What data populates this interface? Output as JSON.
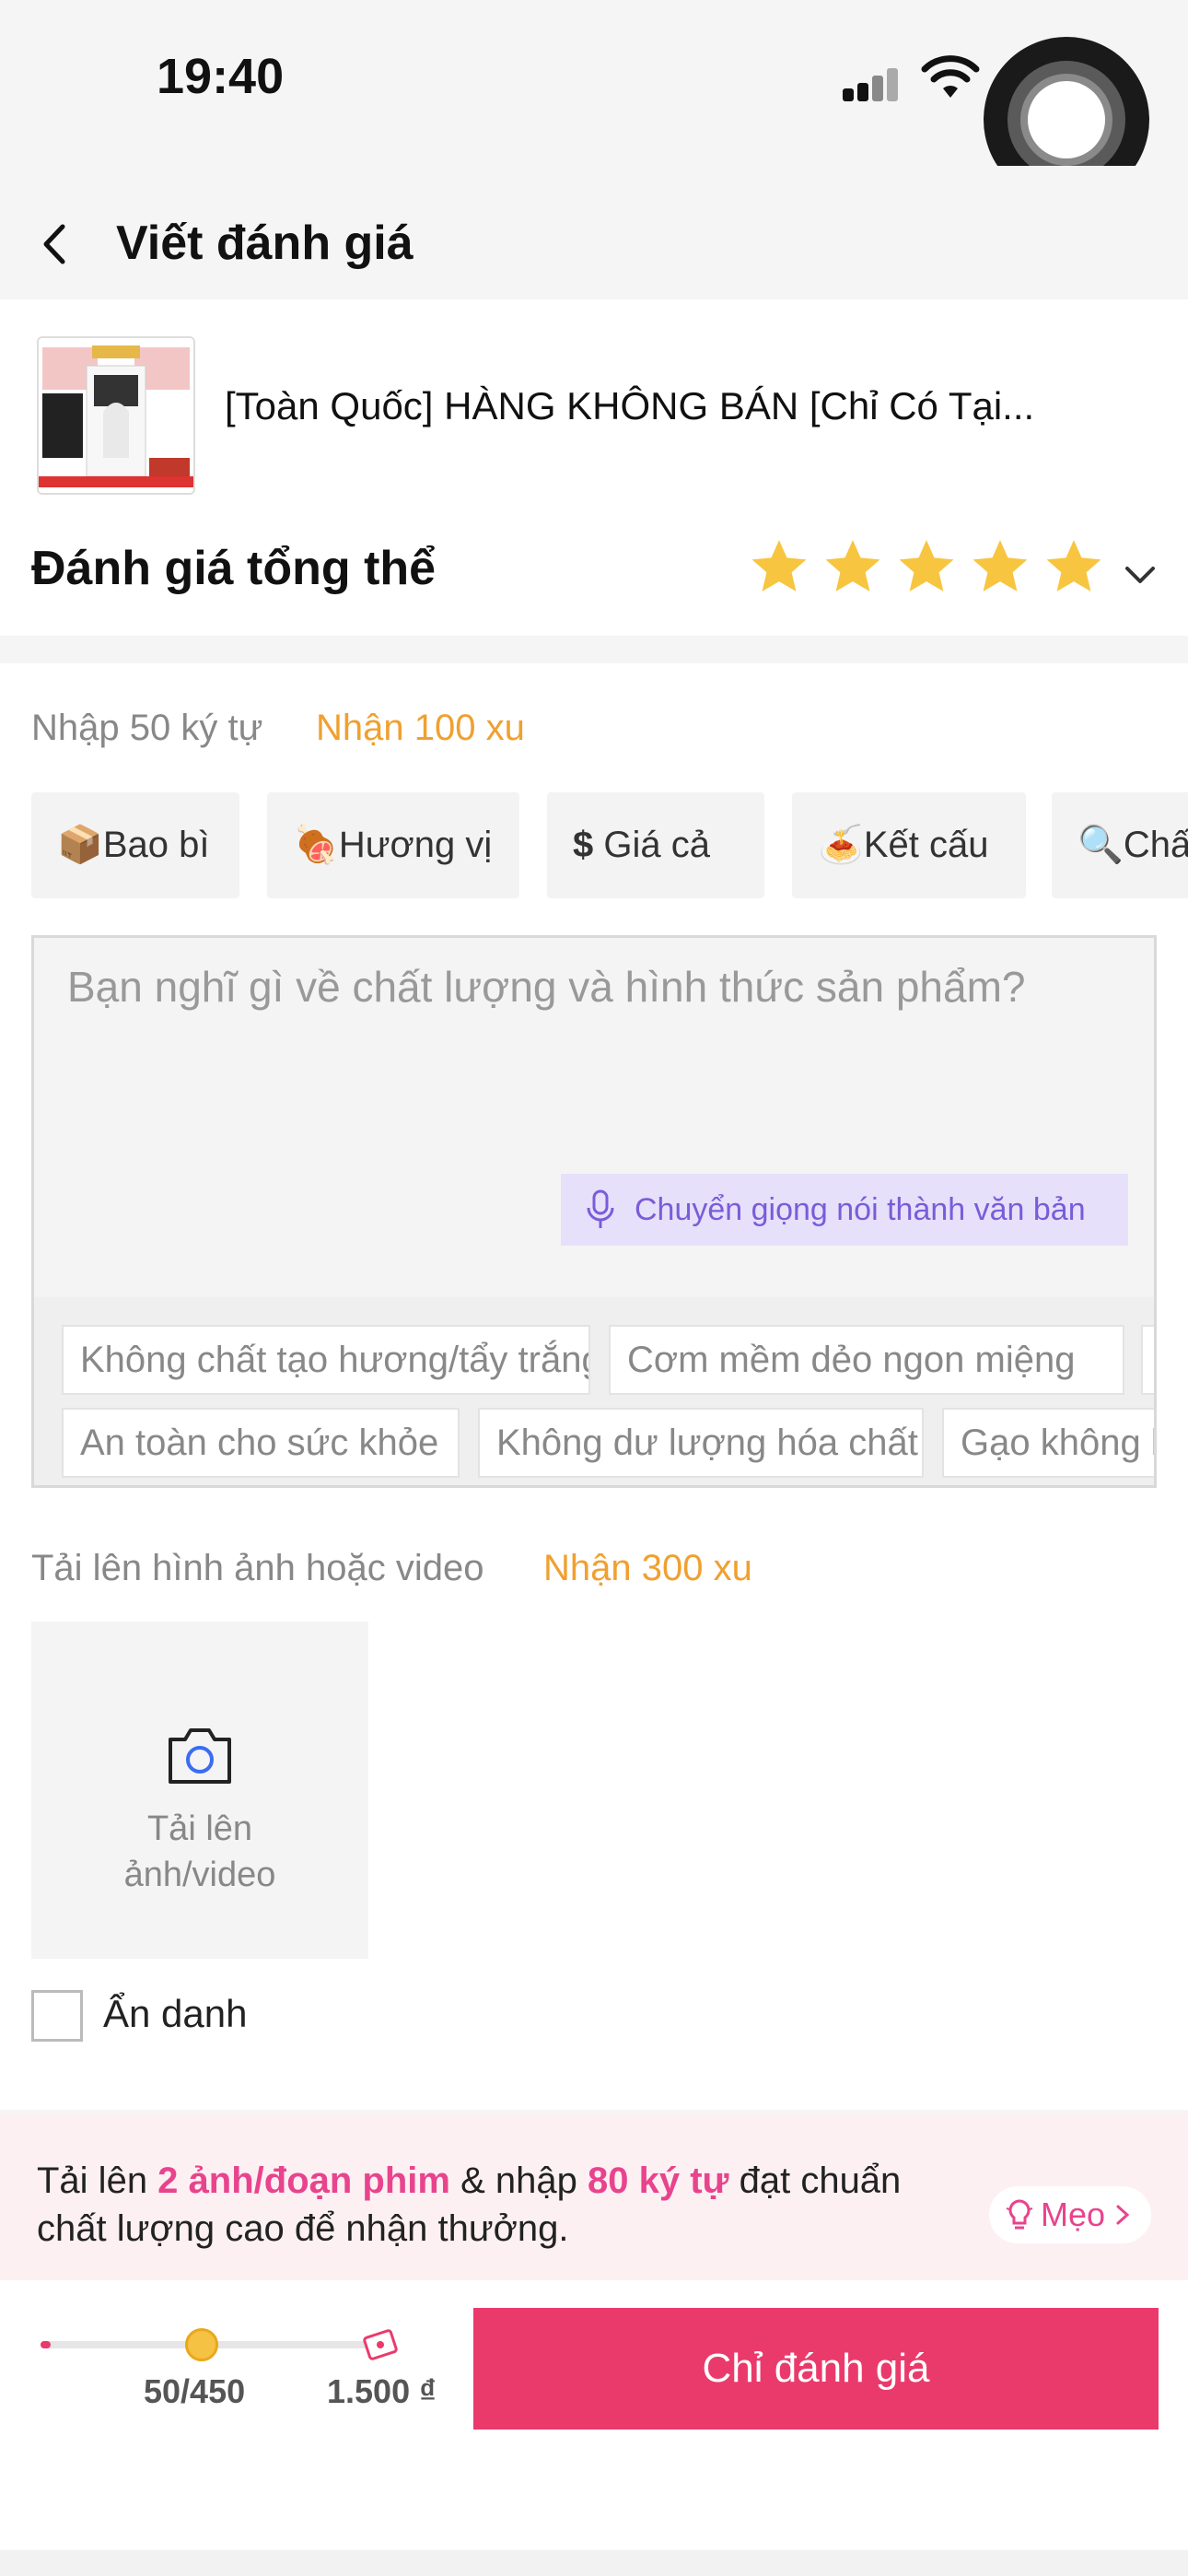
{
  "status_bar": {
    "time": "19:40"
  },
  "header": {
    "title": "Viết đánh giá"
  },
  "product": {
    "name": "[Toàn Quốc] HÀNG KHÔNG BÁN [Chỉ Có Tại...",
    "overall_label": "Đánh giá tổng thể",
    "rating": 5,
    "rating_max": 5,
    "star_color": "#f7c540"
  },
  "review": {
    "char_hint": "Nhập 50 ký tự",
    "char_coin": "Nhận 100 xu",
    "chips": [
      "Bao bì",
      "Hương vị",
      "Giá cả",
      "Kết cấu",
      "Chất lượng"
    ],
    "placeholder": "Bạn nghĩ gì về chất lượng và hình thức sản phẩm?",
    "voice_button": "Chuyển giọng nói thành văn bản",
    "suggestions_row1": [
      "Không chất tạo hương/tẩy trắng",
      "Cơm mềm dẻo ngon miệng"
    ],
    "suggestions_row2": [
      "An toàn cho sức khỏe",
      "Không dư lượng hóa chất",
      "Gạo không bị mốc"
    ]
  },
  "upload": {
    "hint": "Tải lên hình ảnh hoặc video",
    "coin": "Nhận 300 xu",
    "box_label_line1": "Tải lên",
    "box_label_line2": "ảnh/video"
  },
  "anonymous": {
    "label": "Ẩn danh",
    "checked": false
  },
  "banner": {
    "part1": "Tải lên ",
    "hl1": "2 ảnh/đoạn phim",
    "part2": " & nhập ",
    "hl2": "80 ký tự",
    "part3": " đạt chuẩn chất lượng cao để nhận thưởng.",
    "tips": "Mẹo"
  },
  "progress": {
    "count": "50/450",
    "reward": "1.500 ₫",
    "fraction": 0.03
  },
  "submit": {
    "label": "Chỉ đánh giá"
  },
  "colors": {
    "accent": "#ea3a6b",
    "coin": "#f0a030",
    "highlight": "#e8448d",
    "voice": "#7a5cd8"
  }
}
